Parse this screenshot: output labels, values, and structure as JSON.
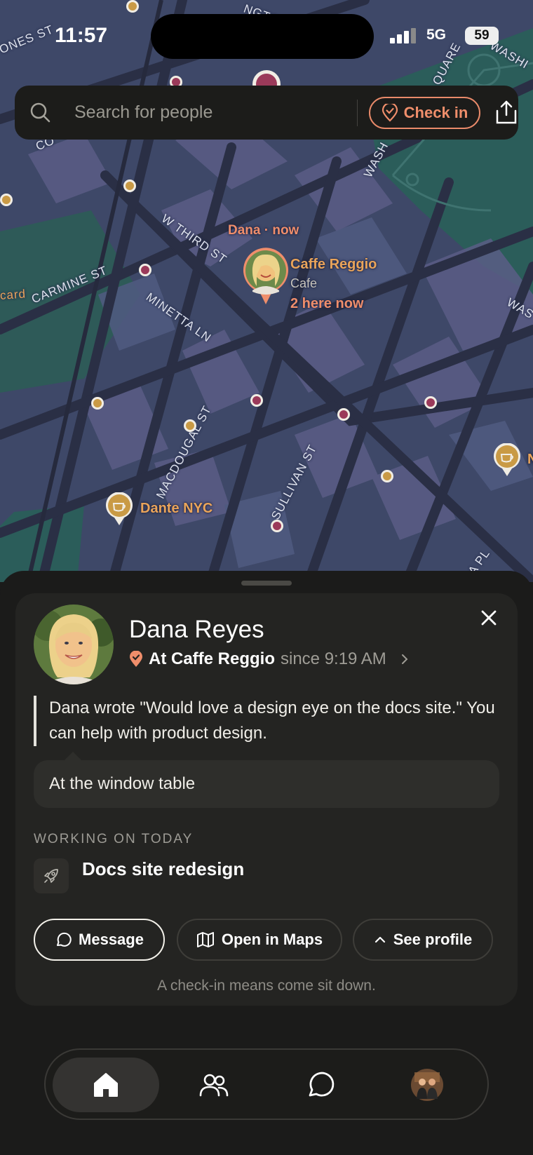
{
  "status_bar": {
    "time": "11:57",
    "network": "5G",
    "battery": "59"
  },
  "search": {
    "placeholder": "Search for people",
    "checkin_label": "Check in"
  },
  "map": {
    "streets": [
      "ONES ST",
      "W THIRD ST",
      "CARMINE ST",
      "MINETTA LN",
      "MACDOUGAL ST",
      "SULLIVAN ST",
      "WASH",
      "QUARE",
      "WASHI",
      "WAS",
      "CO",
      "card",
      "A PL",
      "NGTO"
    ],
    "dana_pin": {
      "label": "Dana · now",
      "place": "Caffe Reggio",
      "category": "Cafe",
      "count": "2 here now"
    },
    "cafe_pins": [
      {
        "name": "Dante NYC"
      },
      {
        "name": "N"
      }
    ],
    "colors": {
      "accent": "#ef8e6b",
      "gold": "#c99a45",
      "plum": "#9b3a5a"
    }
  },
  "profile": {
    "name": "Dana Reyes",
    "location_label": "At Caffe Reggio",
    "since": "since 9:19 AM",
    "quote": "Dana wrote \"Would love a design eye on the docs site.\" You can help with product design.",
    "note": "At the window table",
    "working_heading": "WORKING ON TODAY",
    "working_item": "Docs site redesign",
    "actions": {
      "message": "Message",
      "maps": "Open in Maps",
      "profile": "See profile"
    },
    "footnote": "A check-in means come sit down."
  },
  "tabs": [
    {
      "icon": "home-icon"
    },
    {
      "icon": "people-icon"
    },
    {
      "icon": "chat-icon"
    },
    {
      "icon": "avatar"
    }
  ]
}
